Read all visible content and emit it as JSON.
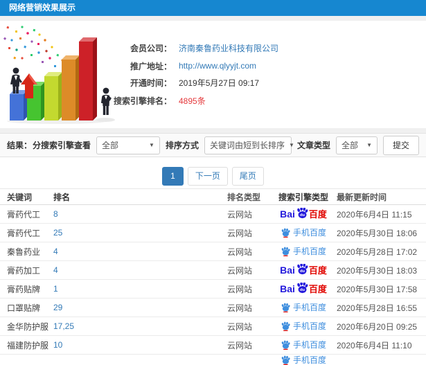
{
  "window": {
    "title": "网络营销效果展示"
  },
  "info_panel": {
    "fields": [
      {
        "label": "会员公司：",
        "value": "济南秦鲁药业科技有限公司"
      },
      {
        "label": "推广地址：",
        "value": "http://www.qlyyjt.com"
      },
      {
        "label": "开通时间：",
        "value": "2019年5月27日 09:17"
      },
      {
        "label": "搜索引擎排名：",
        "value": "4895条"
      }
    ]
  },
  "filter_bar": {
    "result_label": "结果：",
    "engine_view_label": "分搜索引擎查看",
    "engine_view_value": "全部",
    "sort_label": "排序方式",
    "sort_value": "关键词由短到长排序",
    "article_type_label": "文章类型",
    "article_type_value": "全部",
    "submit_label": "提交"
  },
  "pagination": {
    "current_page": "1",
    "next_label": "下一页",
    "last_label": "尾页"
  },
  "table": {
    "headers": [
      "关键词",
      "排名",
      "排名类型",
      "搜索引擎类型",
      "最新更新时间"
    ],
    "baidu_logo": {
      "bai": "Bai",
      "du": "du",
      "cn": "百度"
    },
    "mobile_baidu_label": "手机百度",
    "rows": [
      {
        "keyword": "膏药代工",
        "rank": "8",
        "rank_type": "云网站",
        "engine": "baidu",
        "updated": "2020年6月4日 11:15"
      },
      {
        "keyword": "膏药代工",
        "rank": "25",
        "rank_type": "云网站",
        "engine": "mobile-baidu",
        "updated": "2020年5月30日 18:06"
      },
      {
        "keyword": "秦鲁药业",
        "rank": "4",
        "rank_type": "云网站",
        "engine": "mobile-baidu",
        "updated": "2020年5月28日 17:02"
      },
      {
        "keyword": "膏药加工",
        "rank": "4",
        "rank_type": "云网站",
        "engine": "baidu",
        "updated": "2020年5月30日 18:03"
      },
      {
        "keyword": "膏药贴牌",
        "rank": "1",
        "rank_type": "云网站",
        "engine": "baidu",
        "updated": "2020年5月30日 17:58"
      },
      {
        "keyword": "口罩贴牌",
        "rank": "29",
        "rank_type": "云网站",
        "engine": "mobile-baidu",
        "updated": "2020年5月28日 16:55"
      },
      {
        "keyword": "金华防护服",
        "rank": "17,25",
        "rank_type": "云网站",
        "engine": "mobile-baidu",
        "updated": "2020年6月20日 09:25"
      },
      {
        "keyword": "福建防护服",
        "rank": "10",
        "rank_type": "云网站",
        "engine": "mobile-baidu",
        "updated": "2020年6月4日 11:10"
      },
      {
        "keyword": "",
        "rank": "",
        "rank_type": "",
        "engine": "mobile-baidu",
        "updated": "",
        "partial": true
      }
    ]
  },
  "colors": {
    "header_bg": "#1687d0",
    "link_blue": "#337ab7",
    "highlight_red": "#e4393c",
    "baidu_blue": "#2319dc",
    "baidu_red": "#e10601",
    "mobile_baidu_blue": "#3e8ede"
  }
}
